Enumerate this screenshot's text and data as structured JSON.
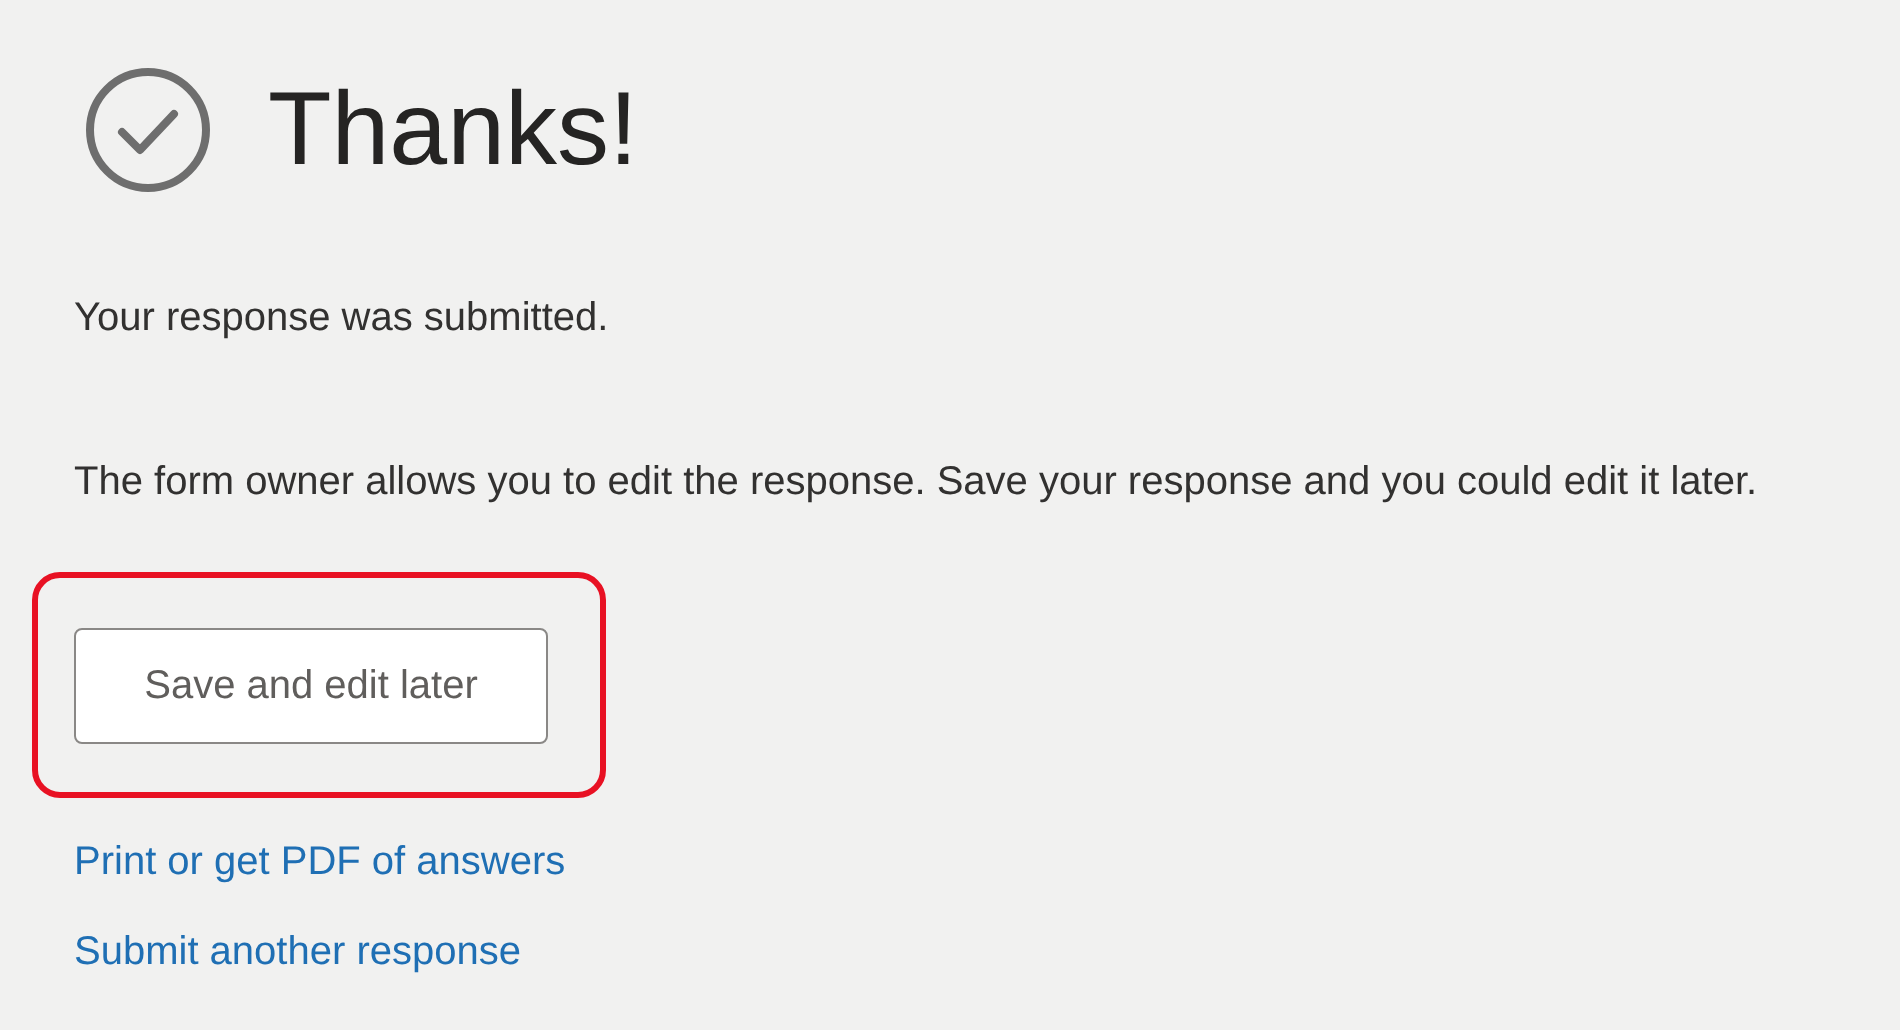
{
  "heading": "Thanks!",
  "confirmation": "Your response was submitted.",
  "edit_note": "The form owner allows you to edit the response. Save your response and you could edit it later.",
  "save_button": {
    "label": "Save and edit later",
    "highlighted": true
  },
  "links": [
    "Print or get PDF of answers",
    "Submit another response"
  ]
}
